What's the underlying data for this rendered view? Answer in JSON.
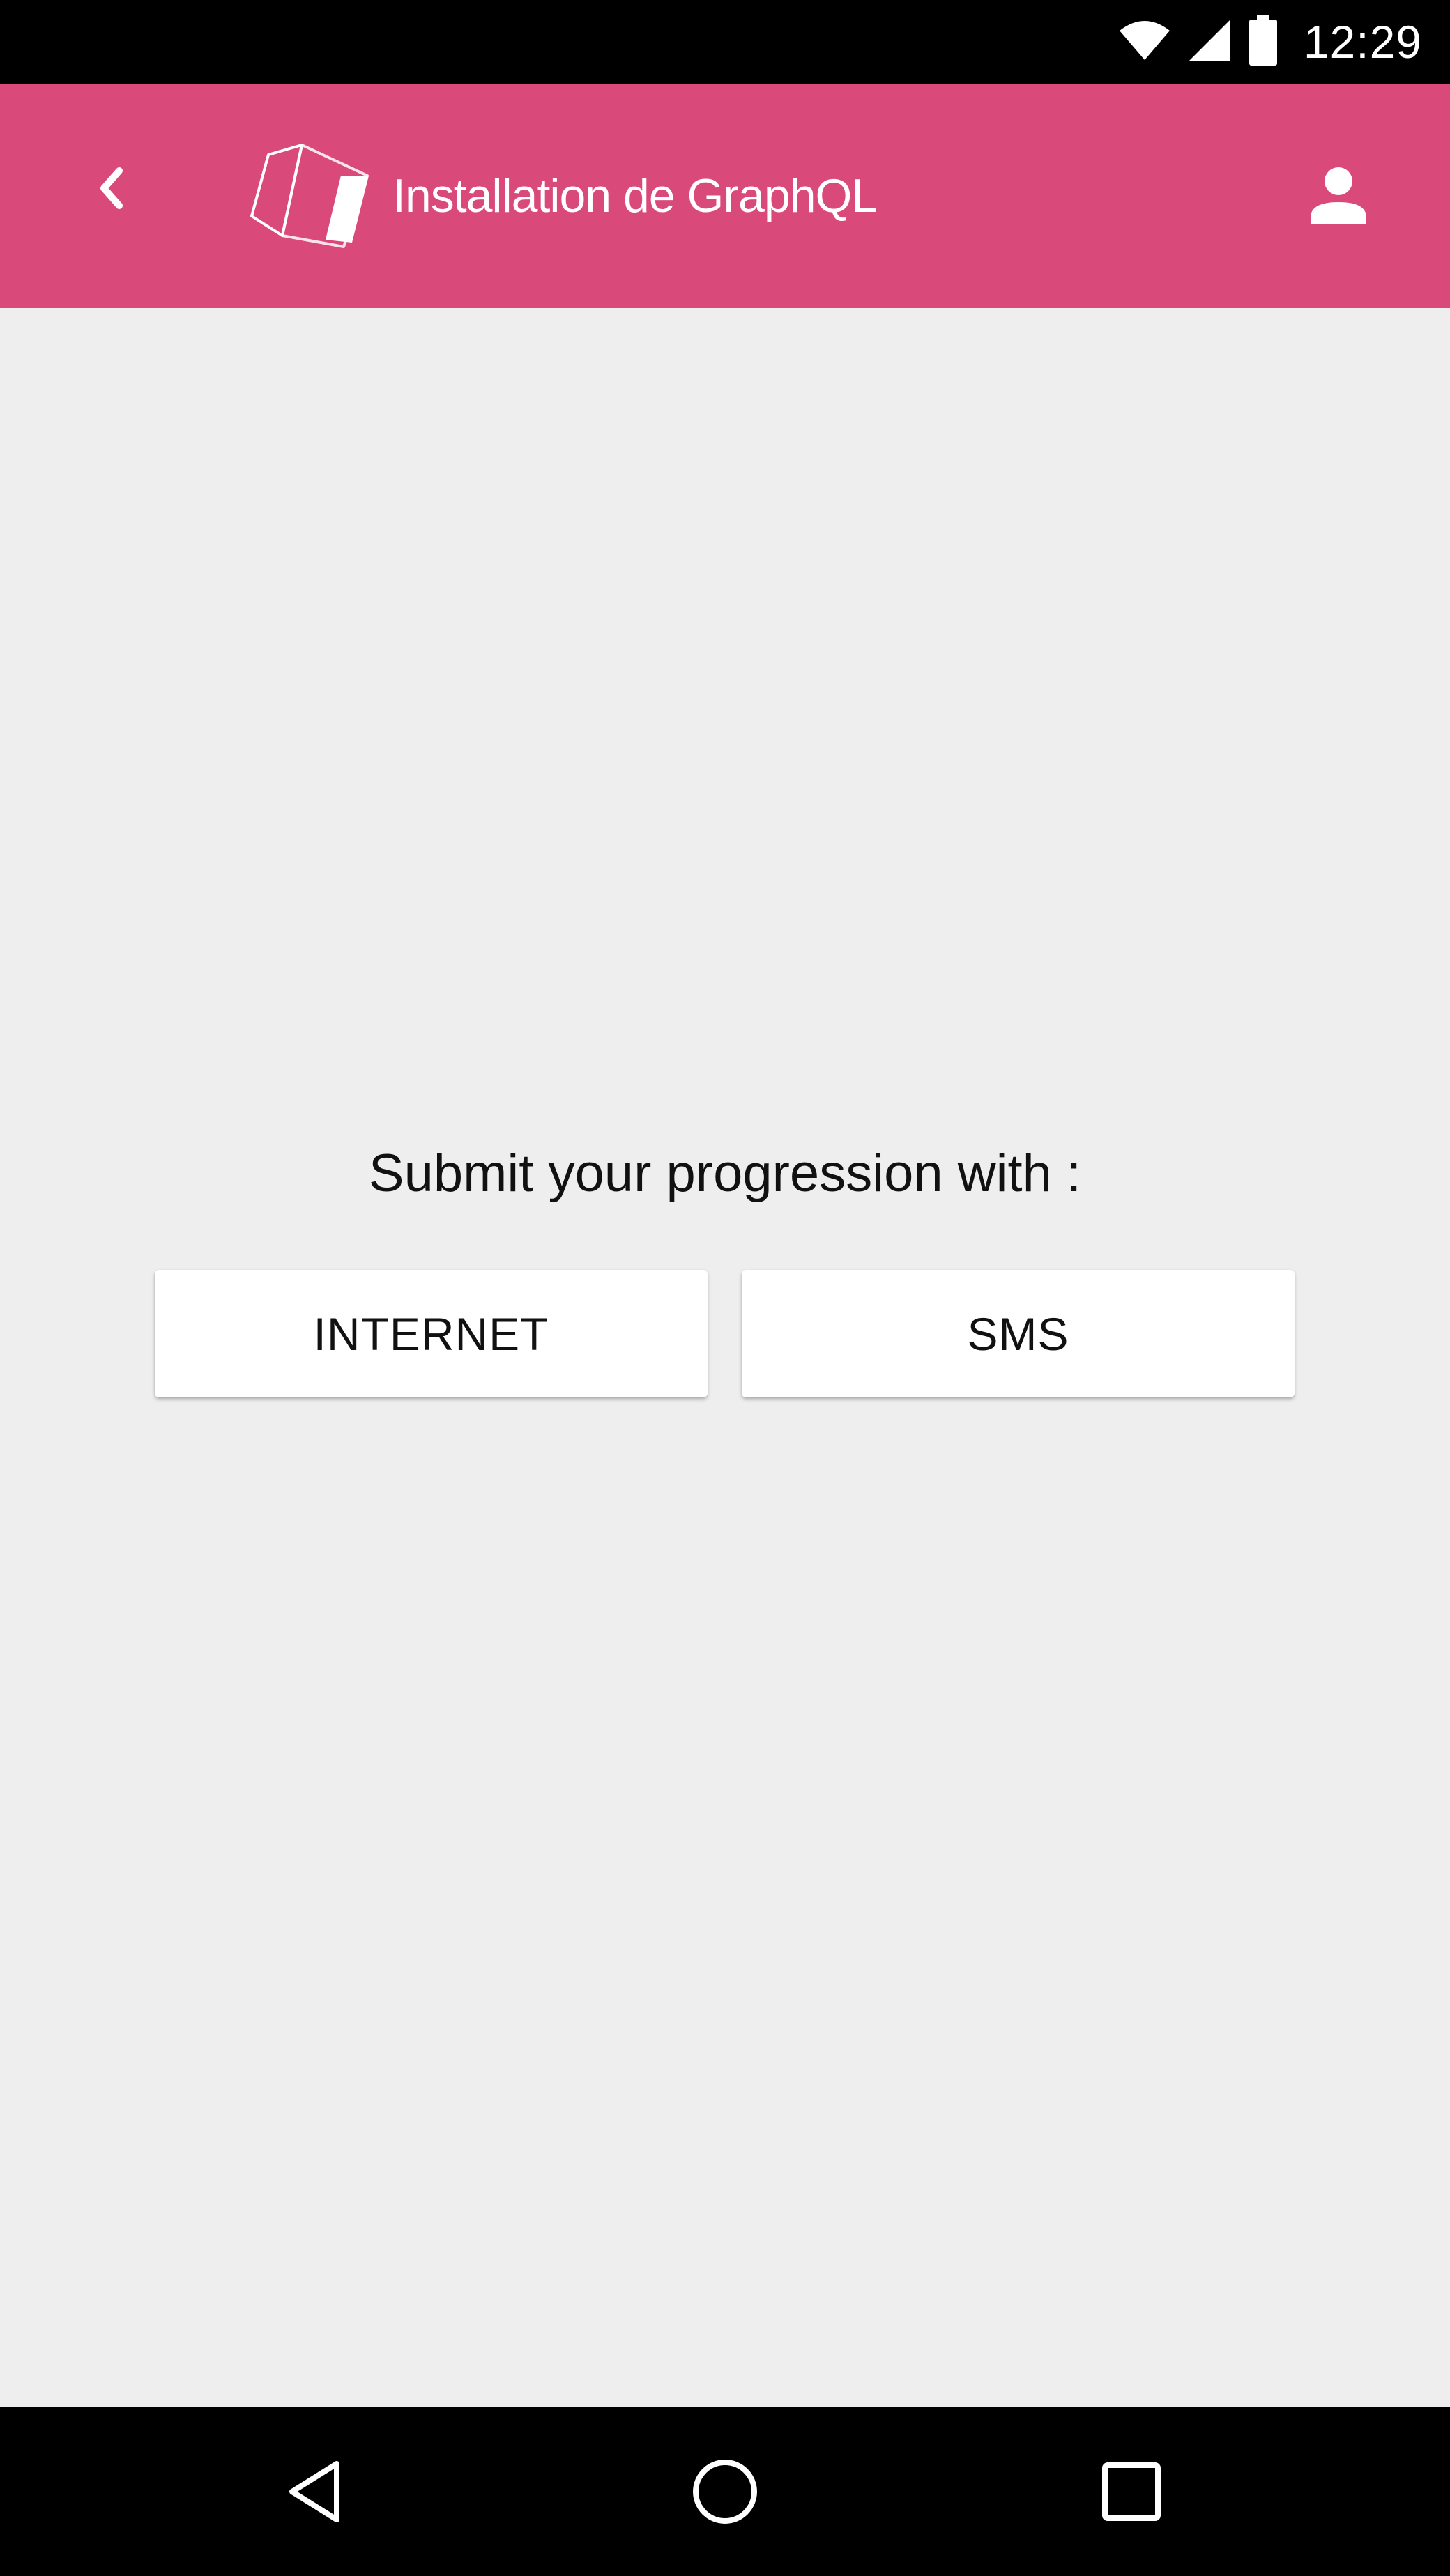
{
  "status_bar": {
    "time": "12:29",
    "icons": [
      "wifi-icon",
      "cellular-signal-icon",
      "battery-icon"
    ]
  },
  "app_bar": {
    "back_icon": "chevron-left-icon",
    "logo_icon": "app-logo-icon",
    "title": "Installation de GraphQL",
    "account_icon": "account-person-icon",
    "color": "#d9497a"
  },
  "main": {
    "prompt": "Submit your progression with :",
    "buttons": [
      {
        "label": "INTERNET"
      },
      {
        "label": "SMS"
      }
    ],
    "background": "#eeeeee"
  },
  "nav_bar": {
    "icons": [
      "nav-back-icon",
      "nav-home-icon",
      "nav-recents-icon"
    ]
  }
}
